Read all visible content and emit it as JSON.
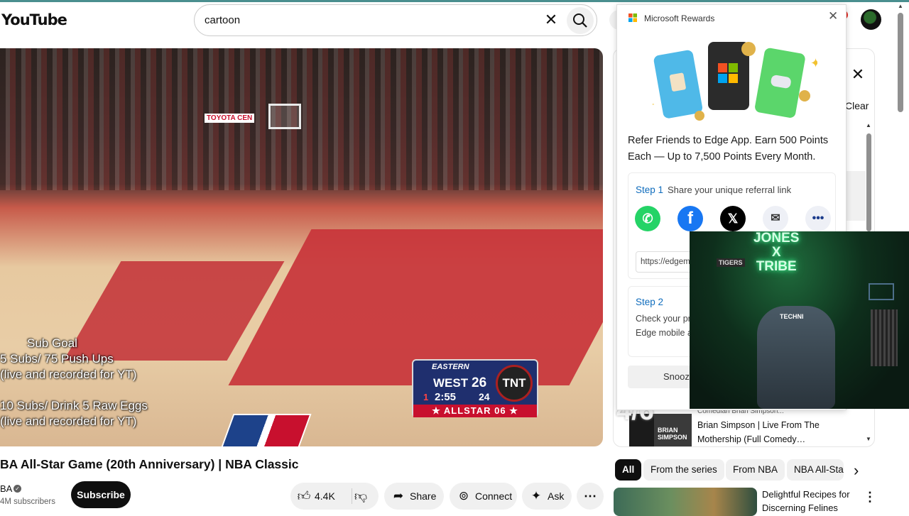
{
  "header": {
    "logo": "YouTube",
    "search_value": "cartoon",
    "clear_glyph": "✕"
  },
  "video": {
    "overlay_lines": [
      "Sub Goal",
      "5 Subs/ 75 Push Ups",
      "(live and recorded for YT)",
      "10 Subs/ Drink 5 Raw Eggs",
      "(live and recorded for YT)"
    ],
    "scorebug": {
      "conference": "EASTERN",
      "team": "WEST",
      "score": "26",
      "quarter": "1",
      "clock": "2:55",
      "shot_clock": "24",
      "network": "TNT",
      "banner": "★ ALLSTAR 06 ★"
    },
    "arena_sign": "TOYOTA CEN"
  },
  "below_video": {
    "title": "BA All-Star Game (20th Anniversary) | NBA Classic",
    "channel": "BA",
    "subscribers": "4M subscribers",
    "subscribe_label": "Subscribe",
    "like_count": "4.4K",
    "share_label": "Share",
    "connect_label": "Connect",
    "ask_label": "Ask",
    "more_glyph": "⋯"
  },
  "right_panel": {
    "close_glyph": "✕",
    "clear_label": "Clear",
    "brian_thumb_text": "BRIAN SIMPSON",
    "brian_title_1": "Brian Simpson | Live From The",
    "brian_title_2": "Mothership (Full Comedy…",
    "strip_text": "Comedian Brian Simpson...",
    "chips": [
      "All",
      "From the series",
      "From NBA",
      "NBA All-Sta"
    ],
    "next_glyph": "›",
    "rec_title_1": "Delightful Recipes for",
    "rec_title_2": "Discerning Felines",
    "rec_menu_glyph": "⋮",
    "watermark": "4/6"
  },
  "rewards": {
    "title": "Microsoft Rewards",
    "close_glyph": "✕",
    "headline_1": "Refer Friends to Edge App. Earn 500 Points",
    "headline_2": "Each — Up to 7,500 Points Every Month.",
    "step1_label": "Step 1",
    "step1_text": "Share your unique referral link",
    "url_value": "https://edgem",
    "step2_label": "Step 2",
    "step2_text_1": "Check your pr",
    "step2_text_2": "Edge mobile a",
    "snooze_label": "Snooze",
    "share_icons": {
      "whatsapp": "✆",
      "facebook": "f",
      "x": "𝕏",
      "mail": "✉",
      "more": "•••"
    }
  },
  "webcam": {
    "sign_line_1": "JONES",
    "sign_line_2": "X",
    "sign_line_3": "TRIBE",
    "chair_brand": "TECHNI",
    "plaque": "TIGERS"
  },
  "colors": {
    "accent_blue": "#0f6cbd",
    "yt_black": "#0f0f0f",
    "chip_bg": "#f0f0f0"
  }
}
